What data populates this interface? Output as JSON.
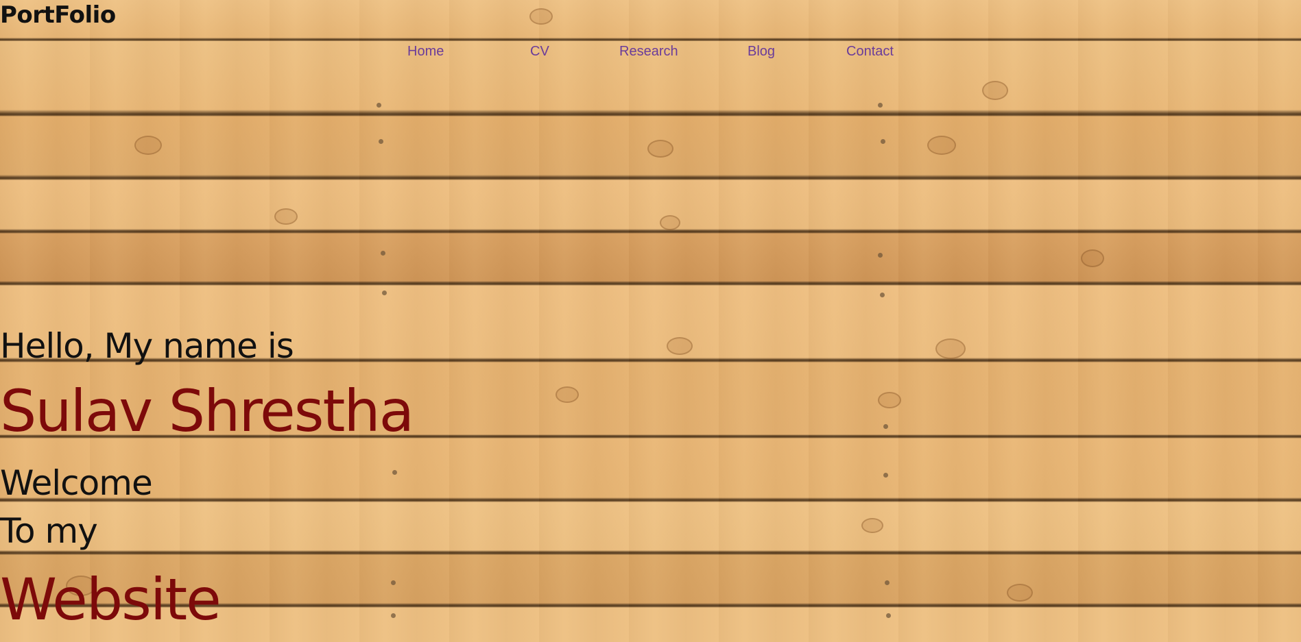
{
  "header": {
    "brand": "PortFolio"
  },
  "nav": {
    "items": [
      {
        "label": "Home"
      },
      {
        "label": "CV"
      },
      {
        "label": "Research"
      },
      {
        "label": "Blog"
      },
      {
        "label": "Contact"
      }
    ]
  },
  "hero": {
    "greeting": "Hello, My name is",
    "name": "Sulav Shrestha",
    "line1": "Welcome",
    "line2": "To my",
    "line3": "Website"
  },
  "colors": {
    "nav_link": "#6a3c9a",
    "accent": "#7d0a0a",
    "text": "#111111",
    "background": "#e9b877"
  }
}
